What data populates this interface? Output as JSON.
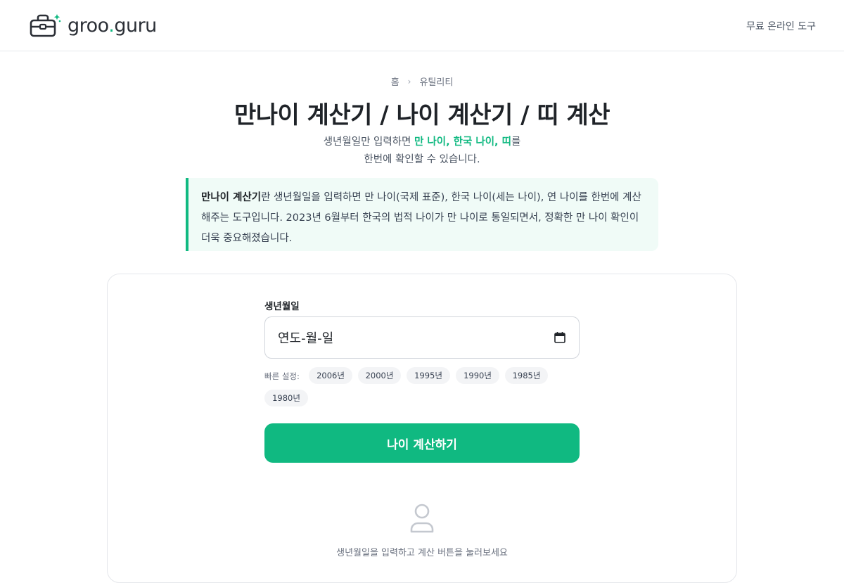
{
  "header": {
    "logo_text_before_dot": "groo",
    "logo_dot": ".",
    "logo_text_after_dot": "guru",
    "logo_icon": "toolbox-sparkle-icon",
    "nav_link": "무료 온라인 도구"
  },
  "breadcrumb": {
    "home": "홈",
    "separator": "›",
    "current": "유틸리티"
  },
  "page": {
    "title": "만나이 계산기 / 나이 계산기 / 띠 계산",
    "subtitle_pre": "생년월일만 입력하면 ",
    "subtitle_highlight": "만 나이, 한국 나이, 띠",
    "subtitle_post": "를",
    "subtitle_line2": "한번에 확인할 수 있습니다."
  },
  "info": {
    "bold": "만나이 계산기",
    "text": "란 생년월일을 입력하면 만 나이(국제 표준), 한국 나이(세는 나이), 연 나이를 한번에 계산해주는 도구입니다. 2023년 6월부터 한국의 법적 나이가 만 나이로 통일되면서, 정확한 만 나이 확인이 더욱 중요해졌습니다."
  },
  "form": {
    "label": "생년월일",
    "date_placeholder": "연도-월-일",
    "calendar_icon": "calendar-icon",
    "quick_label": "빠른 설정:",
    "quick_years": [
      "2006년",
      "2000년",
      "1995년",
      "1990년",
      "1985년",
      "1980년"
    ],
    "submit_label": "나이 계산하기"
  },
  "empty_state": {
    "icon": "user-icon",
    "message": "생년월일을 입력하고 계산 버튼을 눌러보세요"
  },
  "colors": {
    "accent": "#10b981",
    "info_bg": "#f0fbf7",
    "chip_bg": "#f3f4f6",
    "border": "#e5e7eb"
  }
}
